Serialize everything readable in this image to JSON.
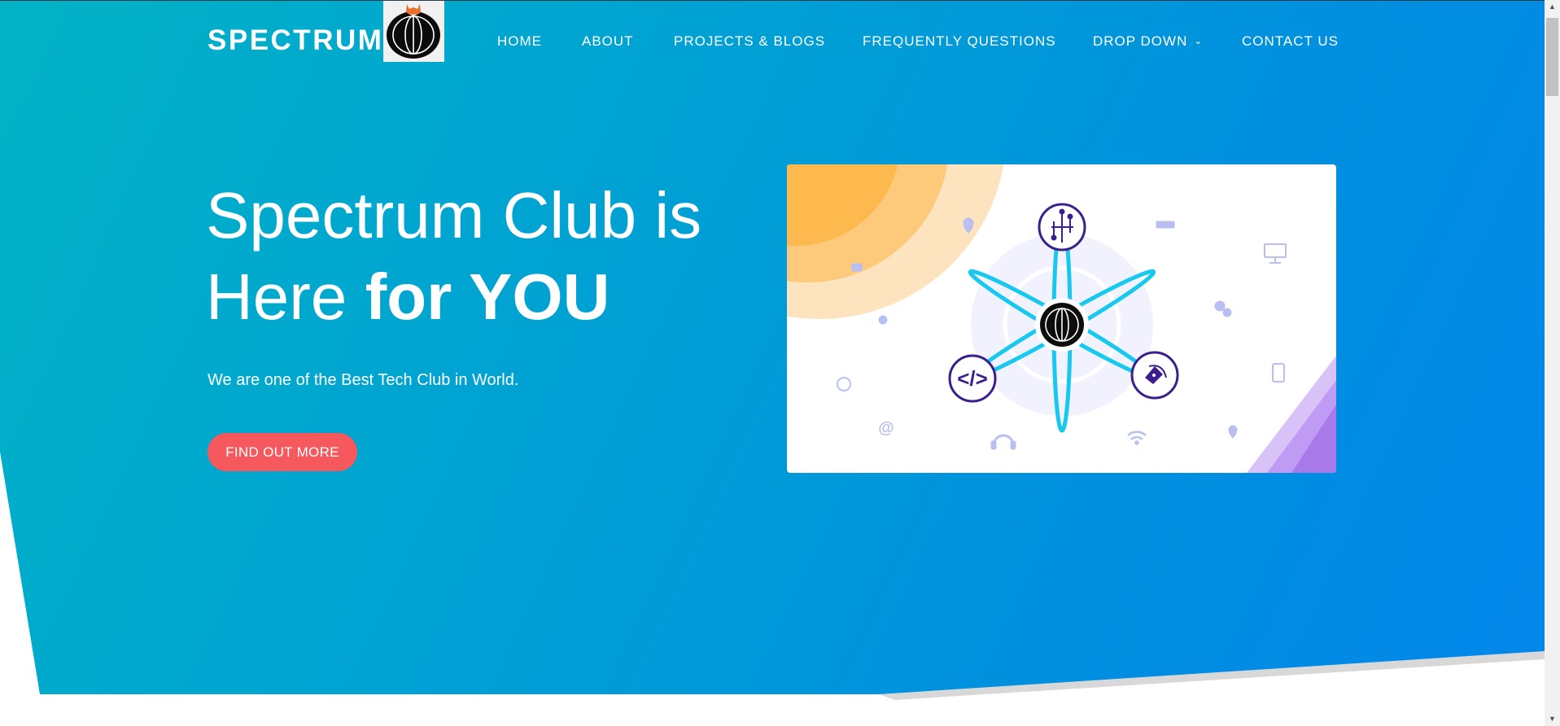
{
  "brand": {
    "name": "SPECTRUM"
  },
  "nav": {
    "home": "HOME",
    "about": "ABOUT",
    "projects": "PROJECTS & BLOGS",
    "faq": "FREQUENTLY QUESTIONS",
    "dropdown": "DROP DOWN",
    "contact": "CONTACT US"
  },
  "hero": {
    "title_line1": "Spectrum Club is",
    "title_line2_regular": "Here ",
    "title_line2_bold": "for YOU",
    "subtitle": "We are one of the Best Tech Club in World.",
    "cta_label": "FIND OUT MORE"
  },
  "icons": {
    "logo": "globe-fox-logo-icon",
    "dropdown_caret": "chevron-down-icon",
    "network_hub": "network-hub-icon",
    "circuit": "circuit-icon",
    "code": "code-icon",
    "pen_tool": "pen-tool-icon"
  },
  "colors": {
    "gradient_start": "#02b3c6",
    "gradient_end": "#0386ea",
    "cta": "#f5595d",
    "accent_purple": "#3b1f8c",
    "accent_cyan": "#12c6ec"
  }
}
